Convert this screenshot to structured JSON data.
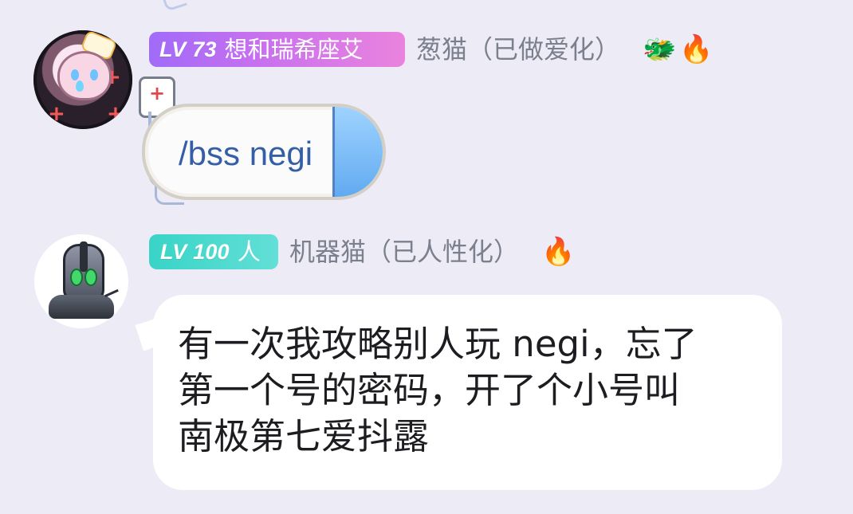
{
  "messages": [
    {
      "badge": {
        "level": "LV 73",
        "title": "想和瑞希座艾"
      },
      "nickname": "葱猫（已做爱化）",
      "decor": {
        "dragon": "🐲",
        "fire": "🔥"
      },
      "command": "/bss negi"
    },
    {
      "badge": {
        "level": "LV 100",
        "title": "人"
      },
      "nickname": "机器猫（已人性化）",
      "decor": {
        "fire": "🔥"
      },
      "text": "有一次我攻略别人玩 negi，忘了\n第一个号的密码，开了个小号叫\n南极第七爱抖露"
    }
  ]
}
